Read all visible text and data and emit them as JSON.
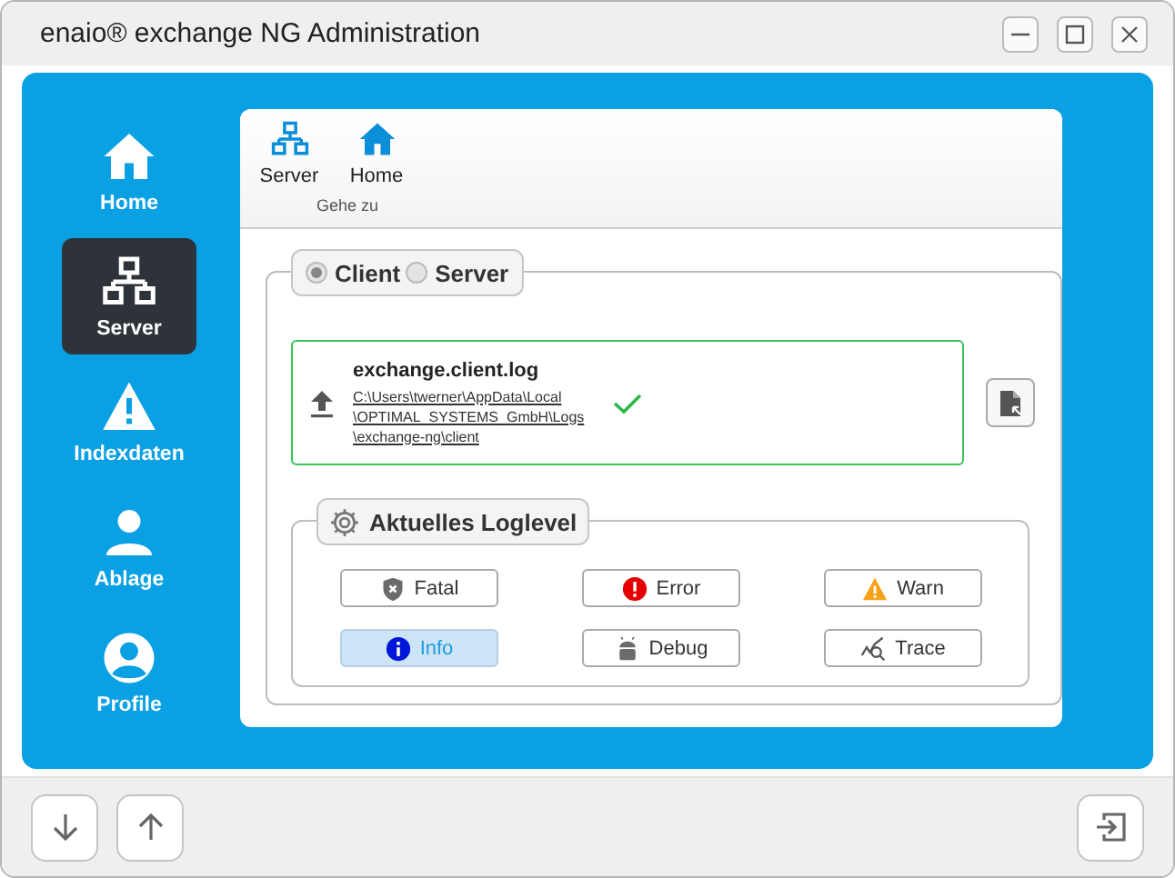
{
  "window": {
    "title": "enaio® exchange NG Administration"
  },
  "sidebar": {
    "items": [
      {
        "label": "Home",
        "kind": "home",
        "selected": false
      },
      {
        "label": "Server",
        "kind": "network",
        "selected": true
      },
      {
        "label": "Indexdaten",
        "kind": "warning",
        "selected": false
      },
      {
        "label": "Ablage",
        "kind": "person",
        "selected": false
      },
      {
        "label": "Profile",
        "kind": "profile",
        "selected": false
      }
    ]
  },
  "ribbon": {
    "items": [
      {
        "label": "Server",
        "kind": "network"
      },
      {
        "label": "Home",
        "kind": "home"
      }
    ],
    "group_label": "Gehe zu"
  },
  "mode": {
    "options": [
      {
        "label": "Client",
        "selected": true
      },
      {
        "label": "Server",
        "selected": false
      }
    ]
  },
  "log_file": {
    "name": "exchange.client.log",
    "path_lines": [
      "C:\\Users\\twerner\\AppData\\Local",
      "\\OPTIMAL_SYSTEMS_GmbH\\Logs",
      "\\exchange-ng\\client"
    ]
  },
  "loglevel": {
    "title": "Aktuelles Loglevel",
    "levels": [
      {
        "label": "Fatal",
        "kind": "fatal",
        "selected": false
      },
      {
        "label": "Error",
        "kind": "error",
        "selected": false
      },
      {
        "label": "Warn",
        "kind": "warn",
        "selected": false
      },
      {
        "label": "Info",
        "kind": "info",
        "selected": true
      },
      {
        "label": "Debug",
        "kind": "debug",
        "selected": false
      },
      {
        "label": "Trace",
        "kind": "trace",
        "selected": false
      }
    ]
  }
}
